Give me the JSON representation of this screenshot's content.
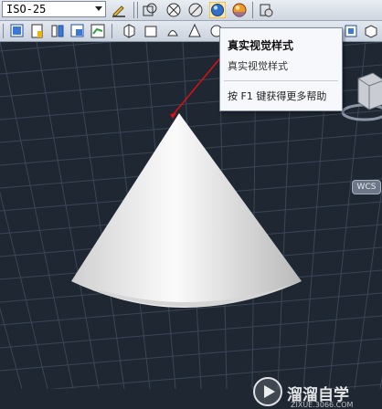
{
  "toolbar": {
    "dimstyle_value": "ISO-25"
  },
  "tooltip": {
    "title": "真实视觉样式",
    "description": "真实视觉样式",
    "help": "按 F1 键获得更多帮助"
  },
  "viewport": {
    "wcs_label": "WCS",
    "background_color": "#1f2733",
    "grid_color": "#3b4656",
    "cone_color": "#e6e6e6"
  },
  "watermark": {
    "name": "溜溜自学",
    "url": "ZIXUE.3066.COM"
  }
}
